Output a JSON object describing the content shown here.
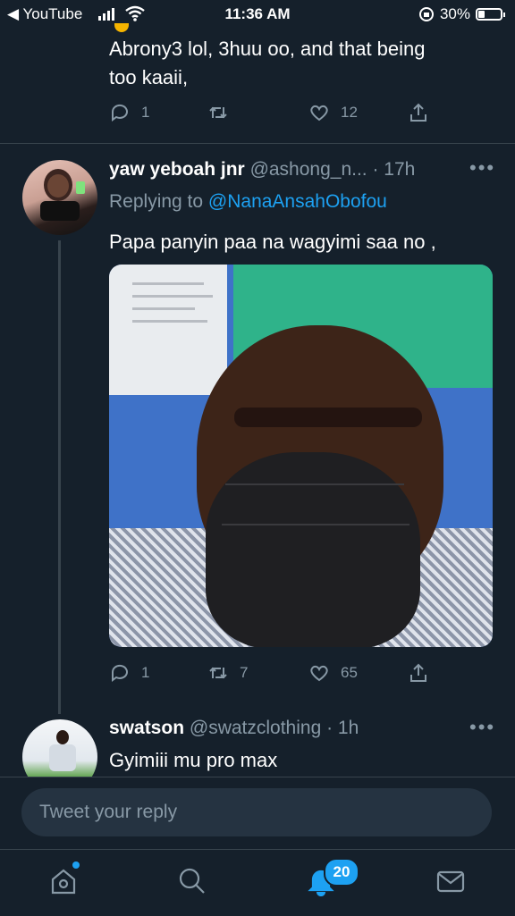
{
  "status": {
    "back_label": "◀ YouTube",
    "time": "11:36 AM",
    "battery": "30%"
  },
  "prev_tweet": {
    "text_line1": "Abrony3 lol, 3huu oo, and that being",
    "text_line2": "too kaaii,",
    "replies": "1",
    "retweets": "",
    "likes": "12"
  },
  "tweet": {
    "name": "yaw yeboah jnr",
    "handle": "@ashong_n...",
    "time": "· 17h",
    "replying_prefix": "Replying to",
    "replying_to": "@NanaAnsahObofou",
    "text": "Papa panyin paa na wagyimi saa no ,",
    "replies": "1",
    "retweets": "7",
    "likes": "65"
  },
  "reply": {
    "name": "swatson",
    "handle": "@swatzclothing",
    "time": "· 1h",
    "text": "Gyimiii mu pro max"
  },
  "composer": {
    "placeholder": "Tweet your reply"
  },
  "tabbar": {
    "notifications_badge": "20"
  },
  "colors": {
    "background": "#15202b",
    "accent": "#1da1f2",
    "muted": "#8899a6"
  }
}
